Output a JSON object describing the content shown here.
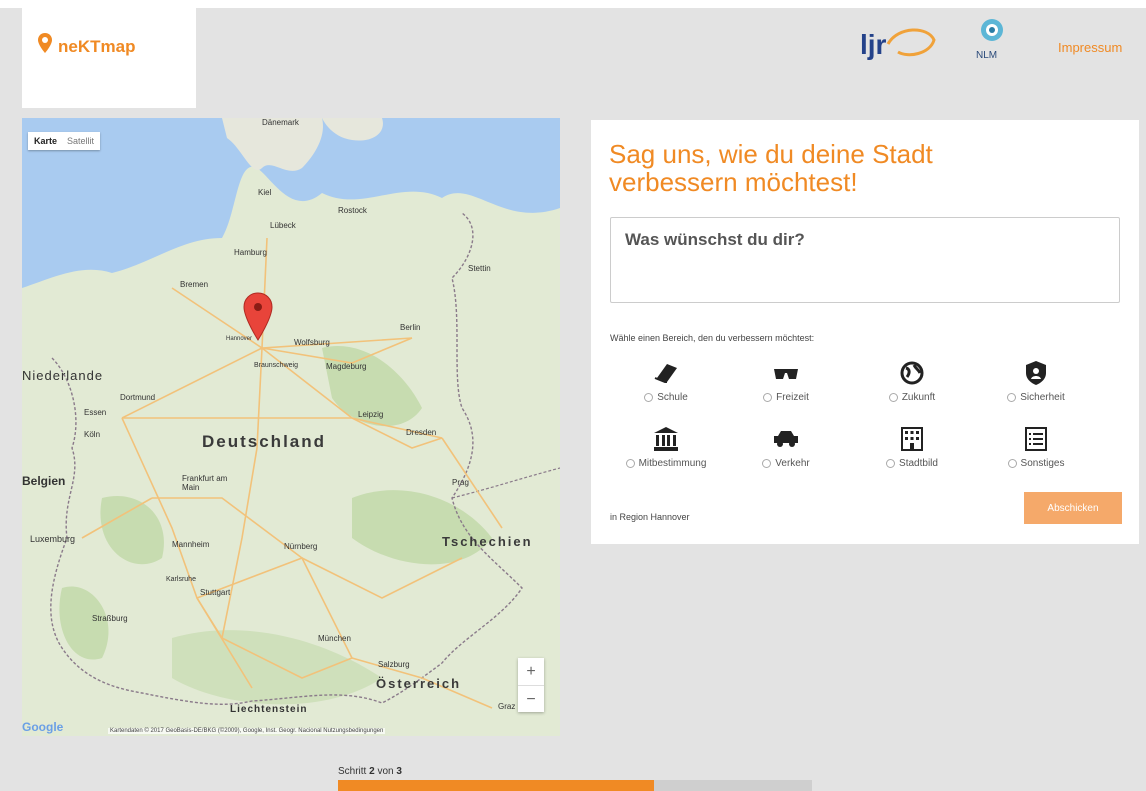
{
  "brand": {
    "name": "neKTmap"
  },
  "header": {
    "impressum_label": "Impressum",
    "logo_ljr": "ljr",
    "logo_nlm": "NLM"
  },
  "map": {
    "type_buttons": [
      "Karte",
      "Satellit"
    ],
    "zoom_in": "+",
    "zoom_out": "−",
    "google_label": "Google",
    "attribution": "Kartendaten © 2017 GeoBasis-DE/BKG (©2009), Google, Inst. Geogr. Nacional   Nutzungsbedingungen",
    "places": {
      "deutschland": "Deutschland",
      "tschechien": "Tschechien",
      "niederlande": "Niederlande",
      "oesterreich": "Österreich",
      "liechtenstein": "Liechtenstein",
      "luxemburg": "Luxemburg",
      "belgien": "Belgien",
      "hamburg": "Hamburg",
      "bremen": "Bremen",
      "berlin": "Berlin",
      "hannover": "Hannover",
      "wolfsburg": "Wolfsburg",
      "magdeburg": "Magdeburg",
      "braunschweig": "Braunschweig",
      "dortmund": "Dortmund",
      "essen": "Essen",
      "koeln": "Köln",
      "leipzig": "Leipzig",
      "dresden": "Dresden",
      "frankfurt": "Frankfurt am Main",
      "nuernberg": "Nürnberg",
      "prag": "Prag",
      "mannheim": "Mannheim",
      "karlsruhe": "Karlsruhe",
      "stuttgart": "Stuttgart",
      "strassburg": "Straßburg",
      "muenchen": "München",
      "salzburg": "Salzburg",
      "graz": "Graz",
      "kiel": "Kiel",
      "luebeck": "Lübeck",
      "rostock": "Rostock",
      "stettin": "Stettin",
      "daenemark": "Dänemark"
    }
  },
  "form": {
    "headline": "Sag uns, wie du deine Stadt verbessern möchtest!",
    "wish_placeholder": "Was wünschst du dir?",
    "choose_label": "Wähle einen Bereich, den du verbessern möchtest:",
    "categories": [
      {
        "label": "Schule",
        "icon": "book-icon"
      },
      {
        "label": "Freizeit",
        "icon": "sunglasses-icon"
      },
      {
        "label": "Zukunft",
        "icon": "globe-icon"
      },
      {
        "label": "Sicherheit",
        "icon": "shield-icon"
      },
      {
        "label": "Mitbestimmung",
        "icon": "institution-icon"
      },
      {
        "label": "Verkehr",
        "icon": "car-icon"
      },
      {
        "label": "Stadtbild",
        "icon": "building-icon"
      },
      {
        "label": "Sonstiges",
        "icon": "list-icon"
      }
    ],
    "region": "in Region Hannover",
    "submit_label": "Abschicken"
  },
  "progress": {
    "step_prefix": "Schritt",
    "current": "2",
    "of": "von",
    "total": "3",
    "fraction": 0.667
  },
  "colors": {
    "accent": "#f08a24",
    "background": "#e3e3e3"
  }
}
